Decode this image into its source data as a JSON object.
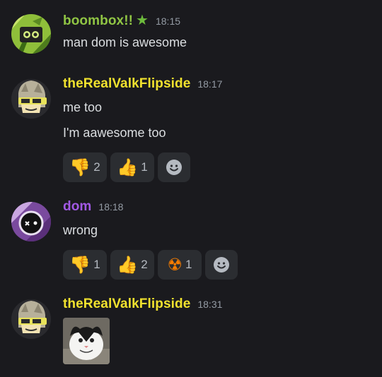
{
  "messages": [
    {
      "username": "boombox!!",
      "username_color": "#90c544",
      "badge": "★",
      "timestamp": "18:15",
      "lines": [
        "man dom is awesome"
      ]
    },
    {
      "username": "theRealValkFlipside",
      "username_color": "#f1e22e",
      "timestamp": "18:17",
      "lines": [
        "me too",
        "I'm aawesome too"
      ],
      "reactions": [
        {
          "emoji": "👎",
          "count": "2"
        },
        {
          "emoji": "👍",
          "count": "1"
        }
      ]
    },
    {
      "username": "dom",
      "username_color": "#a259e5",
      "timestamp": "18:18",
      "lines": [
        "wrong"
      ],
      "reactions": [
        {
          "emoji": "👎",
          "count": "1"
        },
        {
          "emoji": "👍",
          "count": "2"
        },
        {
          "emoji": "☢",
          "count": "1"
        }
      ]
    },
    {
      "username": "theRealValkFlipside",
      "username_color": "#f1e22e",
      "timestamp": "18:31",
      "attachment": "cat-image"
    }
  ],
  "icons": {
    "add_reaction": "smiley-face-icon"
  }
}
